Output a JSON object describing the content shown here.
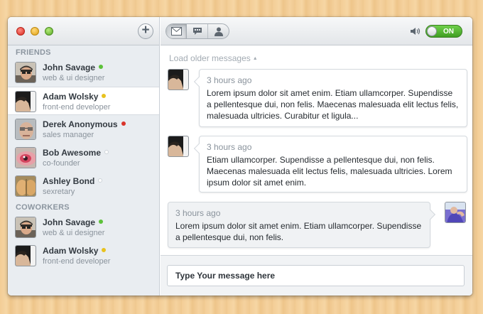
{
  "sidebar": {
    "sections": [
      {
        "label": "FRIENDS",
        "contacts": [
          {
            "name": "John Savage",
            "role": "web & ui designer",
            "status": "online",
            "status_color": "#5cc13a"
          },
          {
            "name": "Adam Wolsky",
            "role": "front-end developer",
            "status": "away",
            "status_color": "#e8c21f"
          },
          {
            "name": "Derek Anonymous",
            "role": "sales manager",
            "status": "busy",
            "status_color": "#d9342b"
          },
          {
            "name": "Bob Awesome",
            "role": "co-founder",
            "status": "offline",
            "status_color": "#cdd3d8"
          },
          {
            "name": "Ashley Bond",
            "role": "sexretary",
            "status": "offline",
            "status_color": "#cdd3d8"
          }
        ]
      },
      {
        "label": "COWORKERS",
        "contacts": [
          {
            "name": "John Savage",
            "role": "web & ui designer",
            "status": "online",
            "status_color": "#5cc13a"
          },
          {
            "name": "Adam Wolsky",
            "role": "front-end developer",
            "status": "away",
            "status_color": "#e8c21f"
          }
        ]
      }
    ],
    "active_contact": "Adam Wolsky"
  },
  "toolbar": {
    "tabs": [
      {
        "icon": "envelope-icon",
        "active": true
      },
      {
        "icon": "chat-bubble-icon",
        "active": false
      },
      {
        "icon": "person-icon",
        "active": false
      }
    ],
    "sound_icon": "speaker-icon",
    "toggle_label": "ON",
    "toggle_color": "#4fb52c"
  },
  "chat": {
    "load_older": "Load older messages",
    "messages": [
      {
        "side": "left",
        "time": "3 hours ago",
        "text": "Lorem ipsum dolor sit amet enim. Etiam ullamcorper. Supendisse a pellentesque dui, non felis. Maecenas malesuada elit lectus felis, malesuada ultricies. Curabitur et ligula..."
      },
      {
        "side": "left",
        "time": "3 hours ago",
        "text": "Etiam ullamcorper. Supendisse a pellentesque dui, non felis. Maecenas malesuada elit lectus felis, malesuada ultricies. Lorem ipsum dolor sit amet enim."
      },
      {
        "side": "right",
        "time": "3 hours ago",
        "text": "Lorem ipsum dolor sit amet enim. Etiam ullamcorper. Supendisse a pellentesque dui, non felis."
      }
    ]
  },
  "composer": {
    "placeholder": "Type Your message here"
  }
}
